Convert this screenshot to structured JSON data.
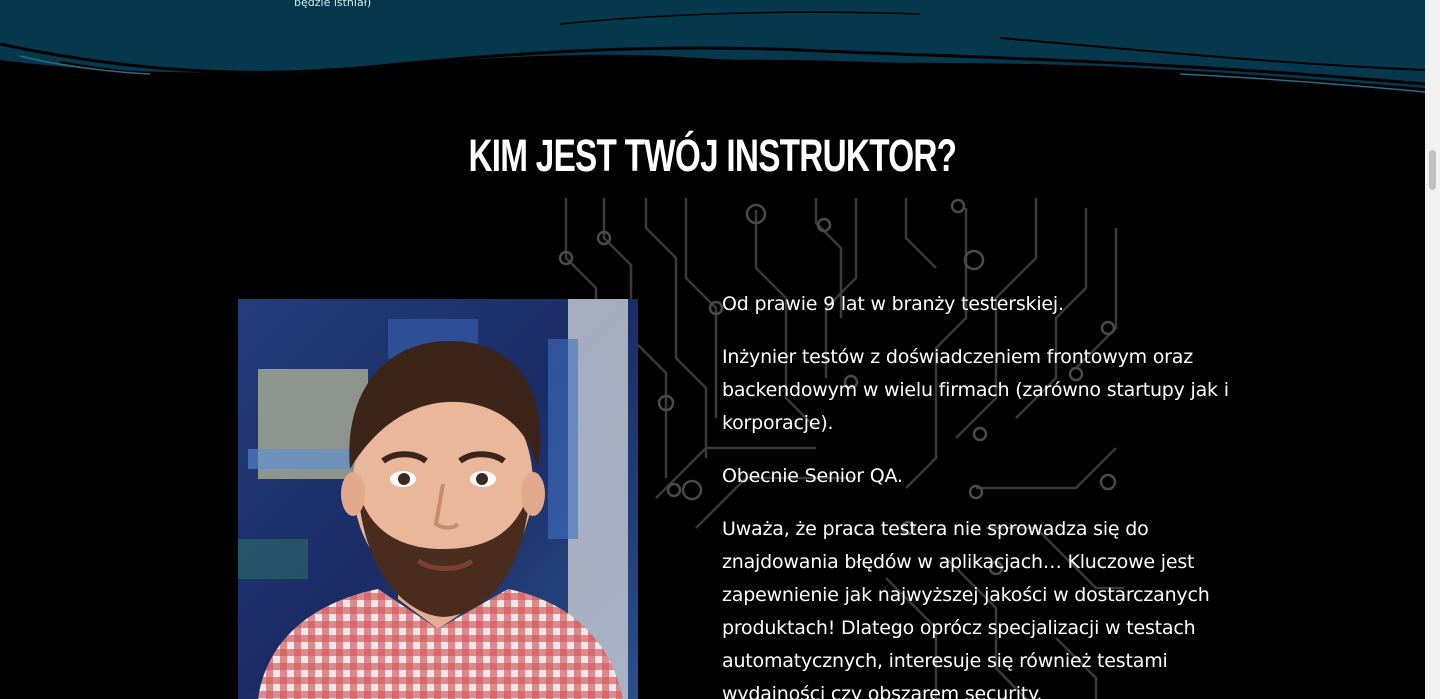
{
  "top_band": {
    "note": "będzie istniał)",
    "color": "#05384d"
  },
  "section": {
    "title": "KIM JEST TWÓJ INSTRUKTOR?"
  },
  "instructor": {
    "photo_icon": "instructor-photo",
    "bio": [
      "Od prawie 9 lat w branży testerskiej.",
      "Inżynier testów z doświadczeniem frontowym oraz backendowym w wielu firmach (zarówno startupy jak i korporacje).",
      "Obecnie Senior QA.",
      "Uważa, że praca testera nie sprowadza się do znajdowania błędów w aplikacjach… Kluczowe jest zapewnienie jak najwyższej jakości w dostarczanych produktach! Dlatego oprócz specjalizacji w testach automatycznych, interesuje się również testami wydajności czy obszarem security."
    ]
  },
  "colors": {
    "background": "#000000",
    "text": "#ffffff",
    "circuit": "#3a3a3a"
  }
}
